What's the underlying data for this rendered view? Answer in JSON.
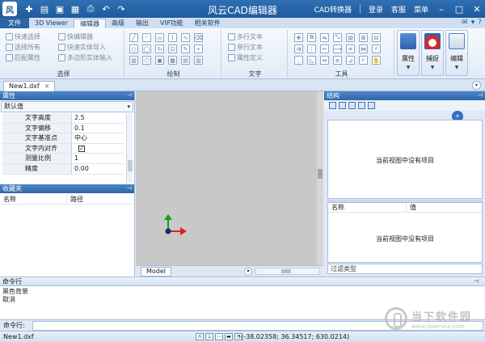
{
  "title_bar": {
    "logo_text": "风",
    "title": "风云CAD编辑器",
    "right_items": [
      "CAD转换器",
      "登录",
      "客服",
      "菜单"
    ],
    "quick_access": [
      "new-icon",
      "open-icon",
      "save-icon",
      "save-as-icon",
      "print-icon",
      "undo-icon",
      "redo-icon"
    ]
  },
  "ribbon_tabs": [
    "文件",
    "3D Viewer",
    "编辑器",
    "高级",
    "输出",
    "VIP功能",
    "相关软件"
  ],
  "active_tab": "编辑器",
  "ribbon": {
    "select_group": {
      "label": "选择",
      "items": [
        "快速选择",
        "选择所有",
        "匹配属性",
        "快编辑器",
        "快速实体导入",
        "多边形实体输入"
      ]
    },
    "draw_group": {
      "label": "绘制"
    },
    "text_group": {
      "label": "文字",
      "items": [
        "多行文本",
        "单行文本",
        "属性定义"
      ]
    },
    "tools_group": {
      "label": "工具"
    },
    "big_buttons": [
      {
        "label": "属性"
      },
      {
        "label": "捕捉"
      },
      {
        "label": "编辑"
      }
    ]
  },
  "document_tab": {
    "name": "New1.dxf",
    "close": "×"
  },
  "properties_panel": {
    "title": "属性",
    "dropdown": "默认值",
    "rows": [
      {
        "key": "文字高度",
        "value": "2.5"
      },
      {
        "key": "文字偏移",
        "value": "0.1"
      },
      {
        "key": "文字基准点",
        "value": "中心"
      },
      {
        "key": "文字内对齐",
        "value": "✓"
      },
      {
        "key": "测量比例",
        "value": "1"
      },
      {
        "key": "精度",
        "value": "0.00"
      }
    ]
  },
  "favorites_panel": {
    "title": "收藏夹",
    "columns": [
      "名称",
      "路径"
    ]
  },
  "canvas": {
    "model_tab": "Model",
    "axis_colors": {
      "x": "#e02020",
      "y": "#10a010",
      "origin": "#1a2a6a"
    }
  },
  "structure_panel": {
    "title": "结构",
    "empty_message": "当前视图中没有项目",
    "add_badge": "+",
    "prop_columns": [
      "名称",
      "值"
    ],
    "prop_empty_message": "当前视图中没有项目",
    "filter_label": "过滤类型"
  },
  "command_panel": {
    "title": "命令行",
    "output_lines": [
      "黑色背景",
      "取消"
    ],
    "input_label": "命令行:"
  },
  "status_bar": {
    "file": "New1.dxf",
    "coordinates": "(-38.02358; 36.34517; 630.0214)"
  },
  "watermark": {
    "text": "当下软件园",
    "url": "www.downxia.com"
  }
}
